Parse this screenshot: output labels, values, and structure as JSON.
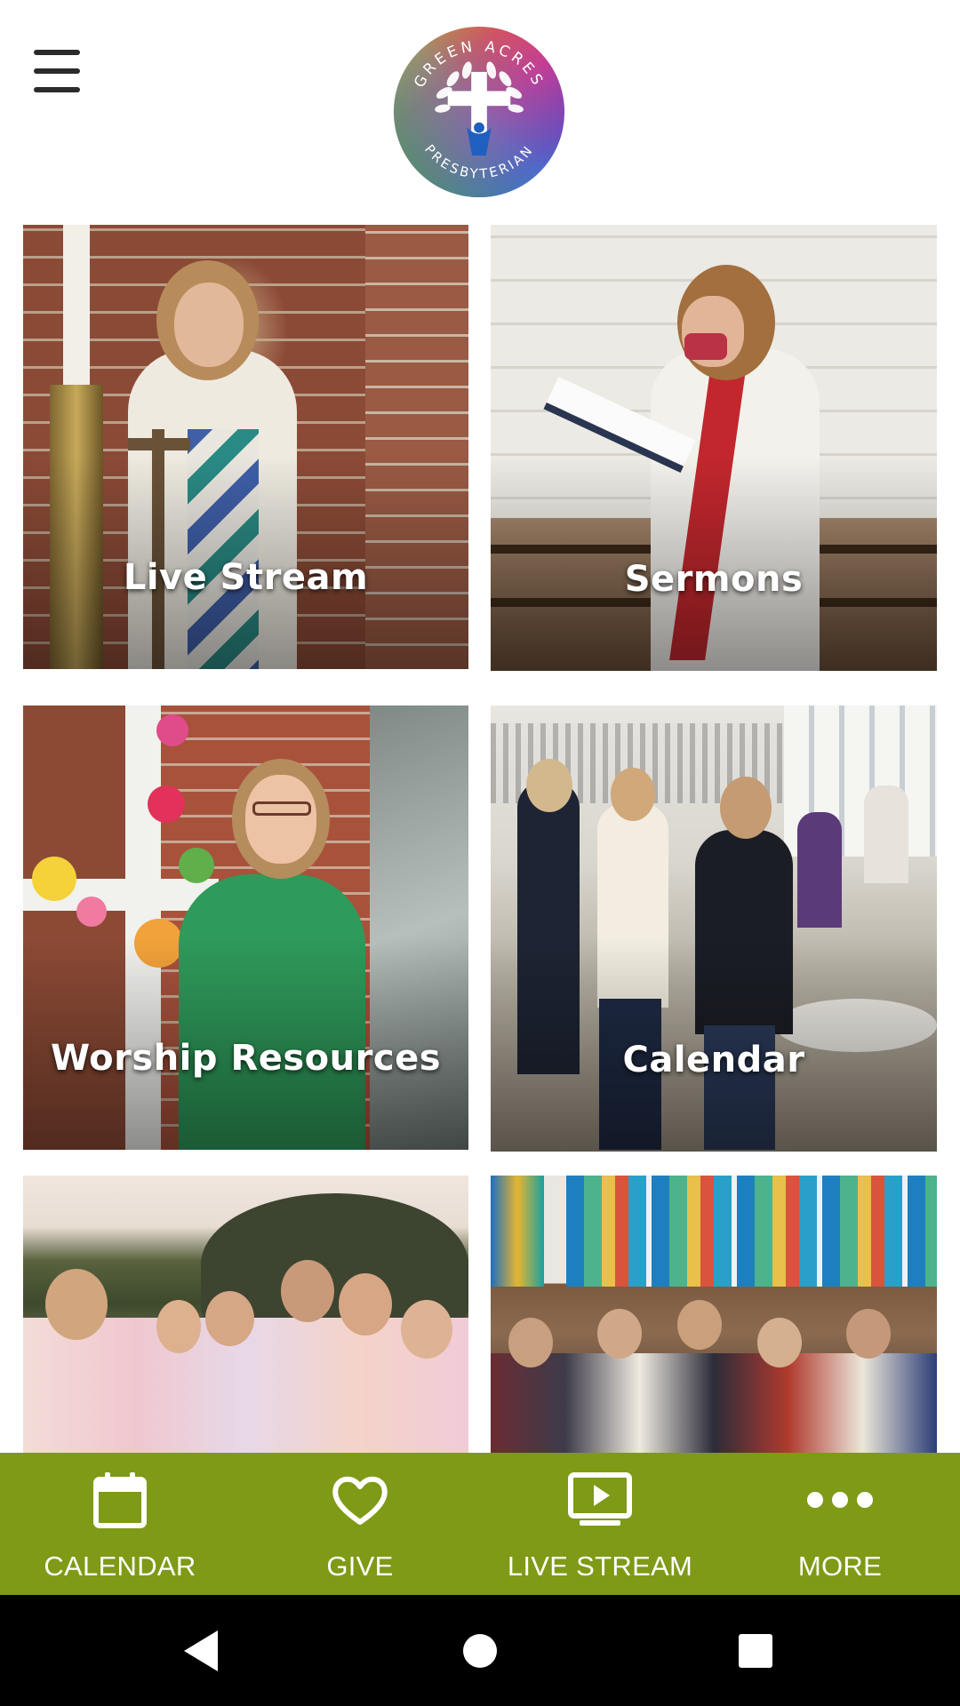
{
  "header": {
    "menu_icon": "hamburger-menu-icon",
    "logo": {
      "text_top": "GREEN ACRES",
      "text_bottom": "PRESBYTERIAN",
      "colors": [
        "#e53935",
        "#fb8c00",
        "#fdd835",
        "#43a047",
        "#1e88e5",
        "#8e24aa"
      ]
    }
  },
  "tiles": [
    {
      "label": "Live Stream"
    },
    {
      "label": "Sermons"
    },
    {
      "label": "Worship Resources"
    },
    {
      "label": "Calendar"
    },
    {
      "label": ""
    },
    {
      "label": ""
    }
  ],
  "tabbar": {
    "background": "#7e9a16",
    "items": [
      {
        "label": "CALENDAR",
        "icon": "calendar-icon"
      },
      {
        "label": "GIVE",
        "icon": "heart-icon"
      },
      {
        "label": "LIVE STREAM",
        "icon": "play-screen-icon"
      },
      {
        "label": "MORE",
        "icon": "more-dots-icon"
      }
    ]
  },
  "system_nav": {
    "buttons": [
      "back-icon",
      "home-icon",
      "recents-icon"
    ]
  }
}
